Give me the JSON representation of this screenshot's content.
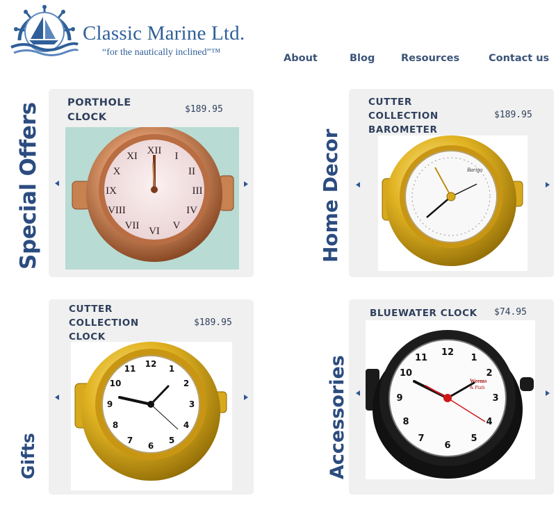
{
  "brand": {
    "name": "Classic Marine Ltd.",
    "tagline": "“for the nautically inclined”™",
    "color": "#2f5f99"
  },
  "nav": {
    "about": "About",
    "blog": "Blog",
    "resources": "Resources",
    "contact": "Contact us"
  },
  "sections": {
    "special_offers": "Special Offers",
    "home_decor": "Home Decor",
    "gifts": "Gifts",
    "accessories": "Accessories"
  },
  "products": [
    {
      "name": "PORTHOLE\nCLOCK",
      "price": "$189.95",
      "image": "rose-gold porthole clock with roman numerals"
    },
    {
      "name": "CUTTER\nCOLLECTION\nBAROMETER",
      "price": "$189.95",
      "image": "brass porthole barometer"
    },
    {
      "name": "CUTTER\nCOLLECTION\nCLOCK",
      "price": "$189.95",
      "image": "brass porthole clock"
    },
    {
      "name": "BLUEWATER CLOCK",
      "price": "$74.95",
      "image": "black bluewater clock"
    }
  ],
  "colors": {
    "card_bg": "#f0f0f0",
    "heading": "#2c4c80",
    "arrow": "#2f5594"
  }
}
